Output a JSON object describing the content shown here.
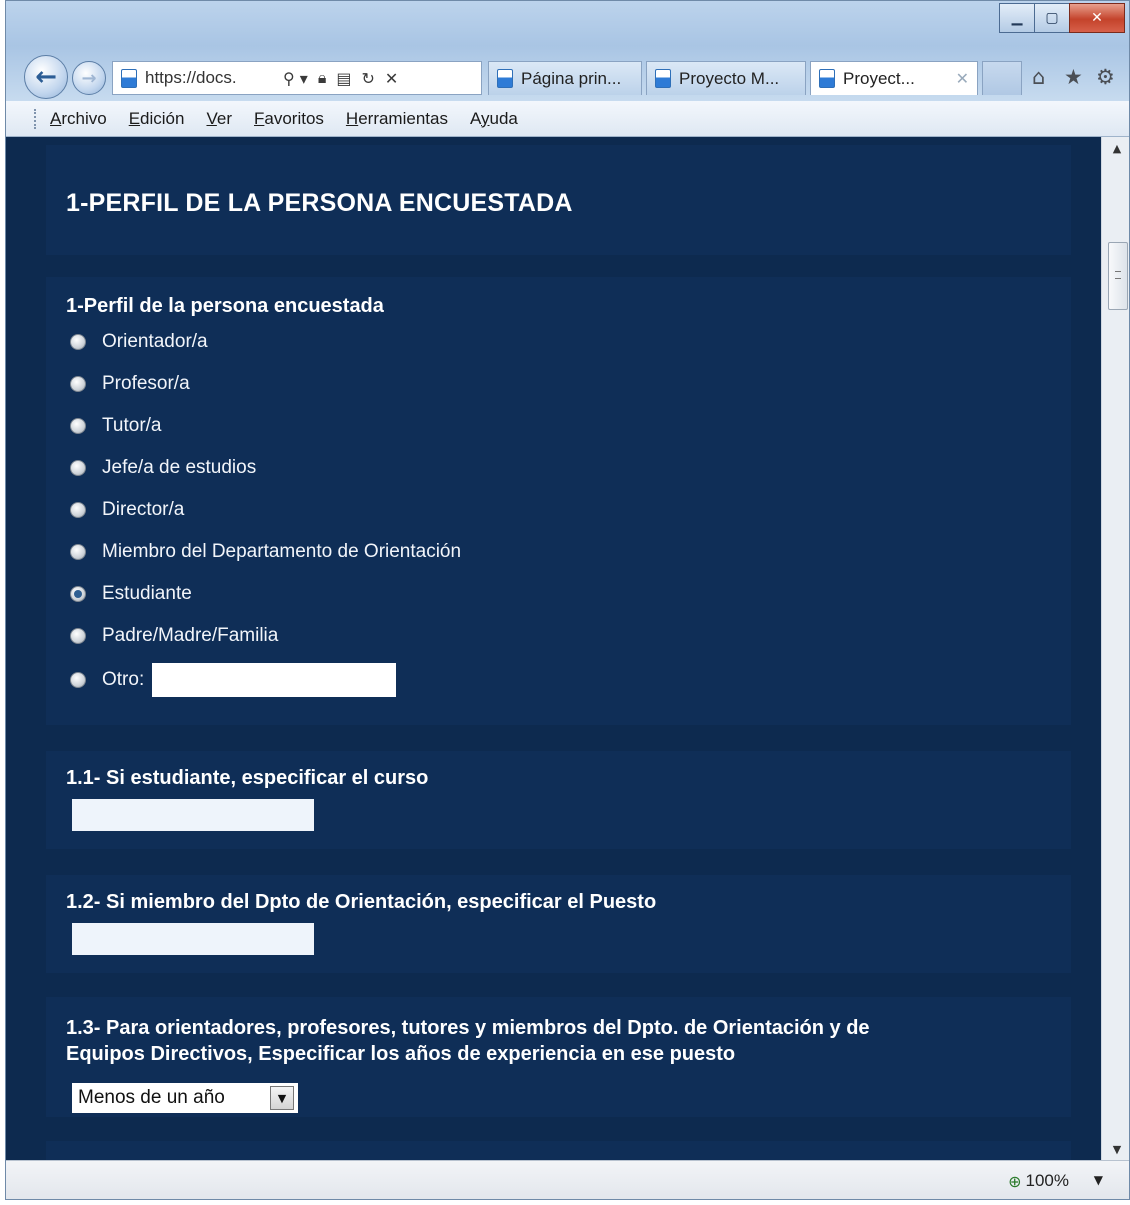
{
  "window": {
    "minimize_icon": "minimize-icon",
    "maximize_icon": "maximize-icon",
    "close_icon": "close-icon"
  },
  "nav": {
    "url": "https://docs.",
    "tabs": [
      {
        "label": "Página prin..."
      },
      {
        "label": "Proyecto M..."
      },
      {
        "label": "Proyect..."
      }
    ]
  },
  "menu": {
    "items": [
      {
        "ul": "A",
        "rest": "rchivo"
      },
      {
        "ul": "E",
        "rest": "dición"
      },
      {
        "ul": "V",
        "rest": "er"
      },
      {
        "ul": "F",
        "rest": "avoritos"
      },
      {
        "ul": "H",
        "rest": "erramientas"
      },
      {
        "pre": "A",
        "ul": "y",
        "rest": "uda"
      }
    ]
  },
  "form": {
    "header_title": "1-PERFIL DE LA PERSONA ENCUESTADA",
    "q1": {
      "title": "1-Perfil de la persona encuestada",
      "options": [
        "Orientador/a",
        "Profesor/a",
        "Tutor/a",
        "Jefe/a de estudios",
        "Director/a",
        "Miembro del Departamento de Orientación",
        "Estudiante",
        "Padre/Madre/Familia",
        "Otro:"
      ],
      "selected": "Estudiante",
      "other_value": ""
    },
    "q1_1": {
      "title": "1.1- Si estudiante, especificar el curso",
      "value": ""
    },
    "q1_2": {
      "title": "1.2- Si miembro del Dpto de Orientación, especificar el Puesto",
      "value": ""
    },
    "q1_3": {
      "title_line1": "1.3- Para orientadores, profesores, tutores y miembros del Dpto. de Orientación y de",
      "title_line2": "Equipos Directivos, Especificar los años de experiencia en ese puesto",
      "selected": "Menos de un año"
    }
  },
  "status": {
    "zoom": "100%"
  }
}
